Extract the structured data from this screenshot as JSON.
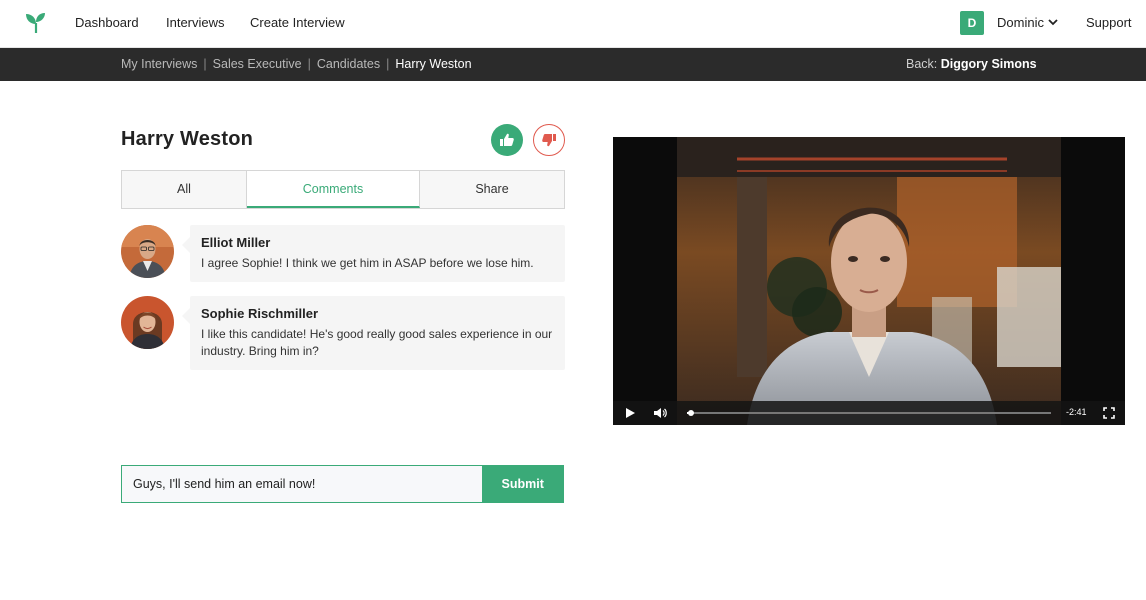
{
  "nav": {
    "links": [
      "Dashboard",
      "Interviews",
      "Create Interview"
    ],
    "user_initial": "D",
    "user_name": "Dominic",
    "support": "Support"
  },
  "breadcrumb": {
    "items": [
      "My Interviews",
      "Sales Executive",
      "Candidates",
      "Harry Weston"
    ],
    "back_label": "Back:",
    "back_name": "Diggory Simons"
  },
  "candidate": {
    "name": "Harry Weston"
  },
  "tabs": [
    "All",
    "Comments",
    "Share"
  ],
  "active_tab": "Comments",
  "comments": [
    {
      "author": "Elliot Miller",
      "text": "I agree Sophie! I think we get him in ASAP before we lose him."
    },
    {
      "author": "Sophie Rischmiller",
      "text": "I like this candidate! He's good really good sales experience in our industry. Bring him in?"
    }
  ],
  "compose": {
    "value": "Guys, I'll send him an email now!",
    "submit_label": "Submit"
  },
  "video": {
    "time_remaining": "-2:41",
    "progress": 0.01
  },
  "colors": {
    "accent": "#3aaa78",
    "negative": "#e05a4e",
    "breadcrumb_bg": "#2b2b2b"
  }
}
